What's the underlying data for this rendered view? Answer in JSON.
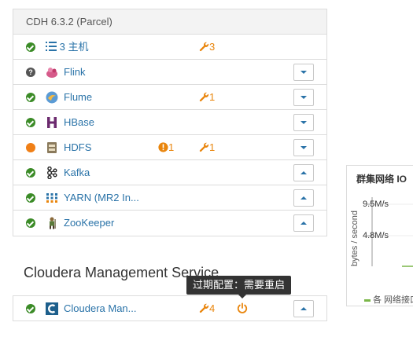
{
  "cluster": {
    "header": "CDH 6.3.2 (Parcel)",
    "hosts": {
      "label": "3 主机",
      "config_issues": "3"
    },
    "services": [
      {
        "name": "Flink",
        "status": "unknown",
        "health_issues": "",
        "config_issues": "",
        "icon": "flink-icon"
      },
      {
        "name": "Flume",
        "status": "good",
        "health_issues": "",
        "config_issues": "1",
        "icon": "flume-icon"
      },
      {
        "name": "HBase",
        "status": "good",
        "health_issues": "",
        "config_issues": "",
        "icon": "hbase-icon"
      },
      {
        "name": "HDFS",
        "status": "concerning",
        "health_issues": "1",
        "config_issues": "1",
        "icon": "hdfs-icon"
      },
      {
        "name": "Kafka",
        "status": "good",
        "health_issues": "",
        "config_issues": "",
        "icon": "kafka-icon"
      },
      {
        "name": "YARN (MR2 In...",
        "status": "good",
        "health_issues": "",
        "config_issues": "",
        "icon": "yarn-icon"
      },
      {
        "name": "ZooKeeper",
        "status": "good",
        "health_issues": "",
        "config_issues": "",
        "icon": "zookeeper-icon"
      }
    ]
  },
  "cms": {
    "title": "Cloudera Management Service",
    "service": {
      "name": "Cloudera Man...",
      "status": "good",
      "config_issues": "4"
    },
    "tooltip": "过期配置：需要重启"
  },
  "chart": {
    "title": "群集网络 IO",
    "ylabel": "bytes / second",
    "ticks": [
      "9.5M/s",
      "4.8M/s"
    ],
    "legend": "各 网络接口"
  },
  "colors": {
    "good": "#3b8b27",
    "concerning": "#f07f16",
    "unknown": "#555555",
    "link": "#2a73a8",
    "warning": "#e9850c"
  }
}
